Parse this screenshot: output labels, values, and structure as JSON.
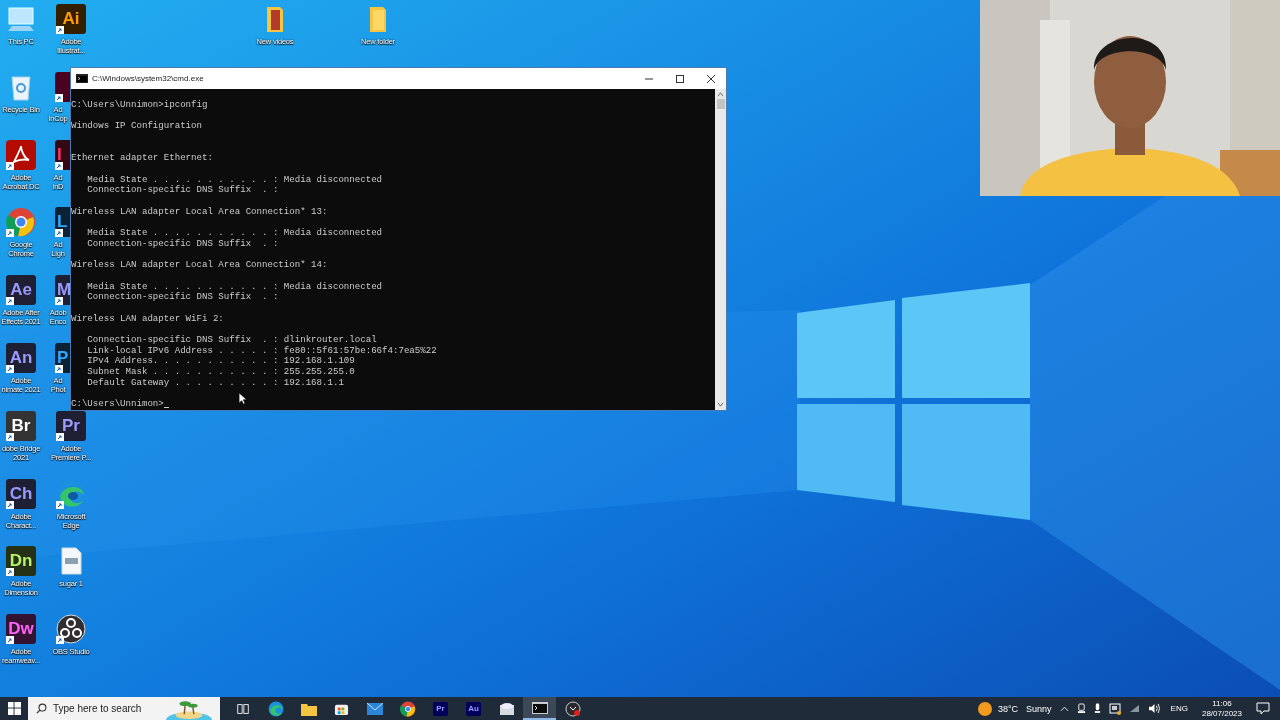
{
  "desktop": {
    "column_1": [
      {
        "kind": "pc",
        "label": "This PC"
      },
      {
        "kind": "recycle",
        "label": "Recycle Bin"
      },
      {
        "kind": "acrobat",
        "label": "Adobe\nAcrobat DC"
      },
      {
        "kind": "chrome",
        "label": "Google\nChrome"
      },
      {
        "kind": "tile",
        "badge": "Ae",
        "color": "#9999ff",
        "label": "Adobe After\nEffects 2021"
      },
      {
        "kind": "tile",
        "badge": "An",
        "color": "#9999ff",
        "label": "Adobe\nnimate 2021"
      },
      {
        "kind": "tile",
        "badge": "Br",
        "color": "#ffffff",
        "label": "dobe Bridge\n2021"
      },
      {
        "kind": "tile",
        "badge": "Ch",
        "color": "#9999ff",
        "label": "Adobe\nCharact..."
      },
      {
        "kind": "tile",
        "badge": "Dn",
        "color": "#b6f36b",
        "label": "Adobe\nDimension"
      },
      {
        "kind": "tile",
        "badge": "Dw",
        "color": "#ff61f6",
        "label": "Adobe\nreamweav..."
      }
    ],
    "column_2": [
      {
        "kind": "tile",
        "badge": "Ai",
        "color": "#ff9a00",
        "label": "Adobe\nIllustrat..."
      },
      {
        "kind": "covered-tile",
        "label": "Ad\nInCop"
      },
      {
        "kind": "covered-tile",
        "badge": "I",
        "color": "#ff3366",
        "label": "Ad\ninD"
      },
      {
        "kind": "covered-tile",
        "badge": "L",
        "color": "#31a8ff",
        "label": "Ad\nLigh"
      },
      {
        "kind": "covered-tile",
        "badge": "M",
        "color": "#9999ff",
        "label": "Adob\nEnco"
      },
      {
        "kind": "covered-tile",
        "badge": "P",
        "color": "#31a8ff",
        "label": "Ad\nPhot"
      },
      {
        "kind": "tile",
        "badge": "Pr",
        "color": "#9999ff",
        "label": "Adobe\nPremiere P..."
      },
      {
        "kind": "edge",
        "label": "Microsoft\nEdge"
      },
      {
        "kind": "document",
        "label": "sugar 1"
      },
      {
        "kind": "obs",
        "label": "OBS Studio"
      }
    ],
    "top_row": [
      {
        "kind": "video-folder",
        "label": "New videos"
      },
      {
        "kind": "folder",
        "label": "New folder"
      }
    ]
  },
  "console": {
    "title": "C:\\Windows\\system32\\cmd.exe",
    "command_line": "C:\\Users\\Unnimon>ipconfig",
    "title_line": "Windows IP Configuration",
    "adapters": [
      {
        "heading": "Ethernet adapter Ethernet:",
        "entries": [
          "   Media State . . . . . . . . . . . : Media disconnected",
          "   Connection-specific DNS Suffix  . :"
        ]
      },
      {
        "heading": "Wireless LAN adapter Local Area Connection* 13:",
        "entries": [
          "   Media State . . . . . . . . . . . : Media disconnected",
          "   Connection-specific DNS Suffix  . :"
        ]
      },
      {
        "heading": "Wireless LAN adapter Local Area Connection* 14:",
        "entries": [
          "   Media State . . . . . . . . . . . : Media disconnected",
          "   Connection-specific DNS Suffix  . :"
        ]
      },
      {
        "heading": "Wireless LAN adapter WiFi 2:",
        "entries": [
          "   Connection-specific DNS Suffix  . : dlinkrouter.local",
          "   Link-local IPv6 Address . . . . . : fe80::5f61:57be:66f4:7ea5%22",
          "   IPv4 Address. . . . . . . . . . . : 192.168.1.109",
          "   Subnet Mask . . . . . . . . . . . : 255.255.255.0",
          "   Default Gateway . . . . . . . . . : 192.168.1.1"
        ]
      }
    ],
    "prompt": "C:\\Users\\Unnimon>"
  },
  "taskbar": {
    "search": {
      "placeholder": "Type here to search"
    },
    "apps": [
      {
        "kind": "taskview",
        "selected": false
      },
      {
        "kind": "edge",
        "selected": false
      },
      {
        "kind": "folder",
        "selected": false
      },
      {
        "kind": "store",
        "selected": false
      },
      {
        "kind": "mail",
        "selected": false
      },
      {
        "kind": "chrome",
        "selected": false
      },
      {
        "kind": "tile",
        "badge": "Pr",
        "selected": false
      },
      {
        "kind": "tile",
        "badge": "Au",
        "selected": false
      },
      {
        "kind": "viewer",
        "selected": false
      },
      {
        "kind": "terminal",
        "selected": true
      },
      {
        "kind": "recorder",
        "selected": false
      }
    ],
    "weather": {
      "temperature": "38°C",
      "condition": "Sunny"
    },
    "language": "ENG",
    "time": "11:06",
    "date": "28/07/2023"
  }
}
